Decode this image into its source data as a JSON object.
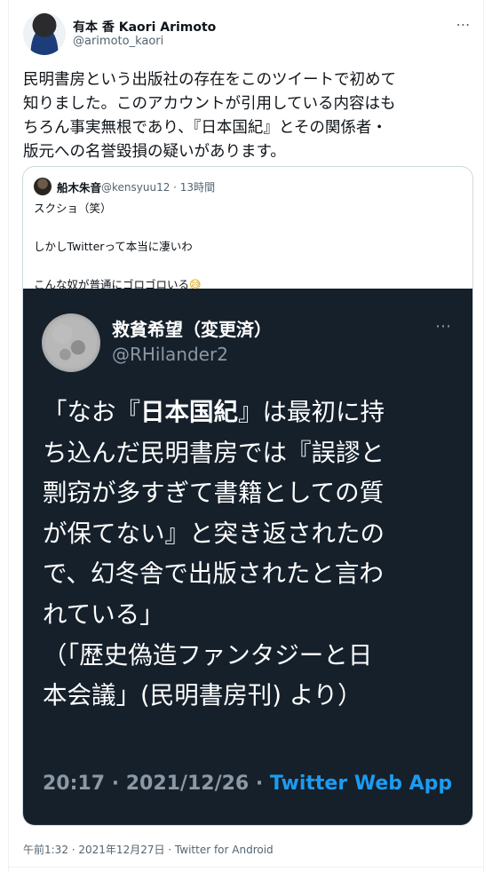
{
  "author": {
    "display_name": "有本 香 Kaori Arimoto",
    "handle": "@arimoto_kaori",
    "more_icon": "⋯"
  },
  "tweet": {
    "text": "民明書房という出版社の存在をこのツイートで初めて\n知りました。このアカウントが引用している内容はも\nちろん事実無根であり、『日本国紀』とその関係者・\n版元への名誉毀損の疑いがあります。"
  },
  "quote": {
    "name": "船木朱音",
    "handle": "@kensyuu12",
    "time": "13時間",
    "lines": [
      "スクショ（笑）",
      "",
      "しかしTwitterって本当に凄いわ",
      "",
      "こんな奴が普通にゴロゴロいる"
    ],
    "emoji": "😅",
    "screenshot": {
      "name": "救貧希望（変更済）",
      "handle": "@RHilander2",
      "more_icon": "⋯",
      "line1_pre": "「なお『",
      "line1_bold": "日本国紀",
      "line1_post": "』は最初に持",
      "lines": [
        "ち込んだ民明書房では『誤謬と",
        "剽窃が多すぎて書籍としての質",
        "が保てない』と突き返されたの",
        "で、幻冬舎で出版されたと言わ",
        "れている」",
        "（「歴史偽造ファンタジーと日",
        "本会議」(民明書房刊) より）"
      ],
      "footer_time": "20:17 · 2021/12/26 · ",
      "footer_app": "Twitter Web App"
    }
  },
  "footer": {
    "timestamp": "午前1:32 · 2021年12月27日 · Twitter for Android"
  },
  "colors": {
    "text": "#0f1419",
    "secondary": "#536471",
    "link": "#1d9bf0",
    "dark_bg": "#15202b"
  }
}
